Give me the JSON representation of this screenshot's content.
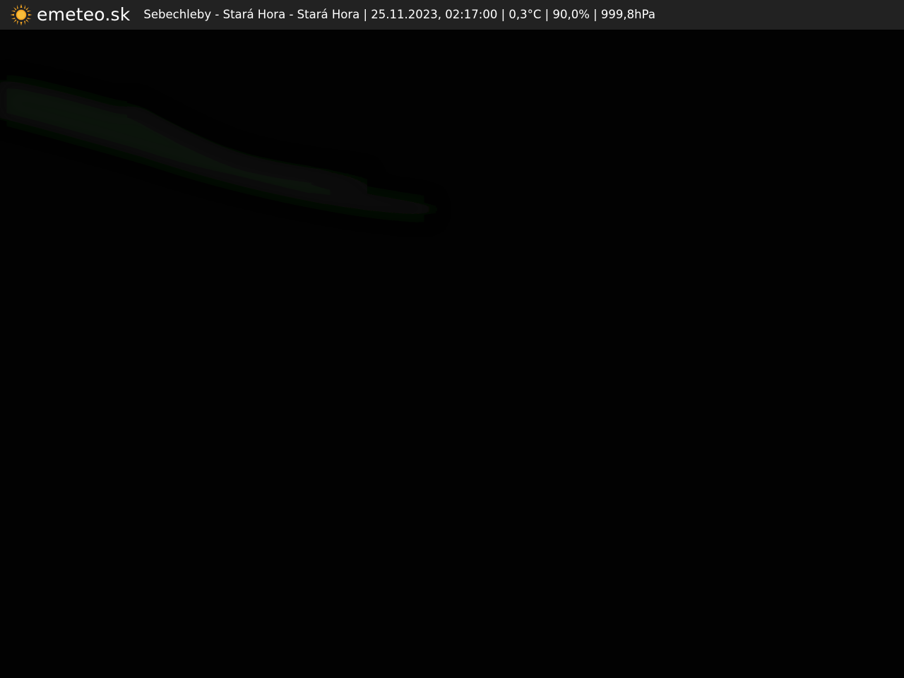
{
  "header": {
    "logo_text": "emeteo.sk",
    "logo_icon": "sun-icon",
    "logo_color": "#f5a623",
    "status_text": "Sebechleby - Stará Hora - Stará Hora | 25.11.2023, 02:17:00 | 0,3°C | 90,0% | 999,8hPa",
    "background": "#222222"
  },
  "camera": {
    "background": "#020202",
    "faint_tint": "#0e1409"
  }
}
